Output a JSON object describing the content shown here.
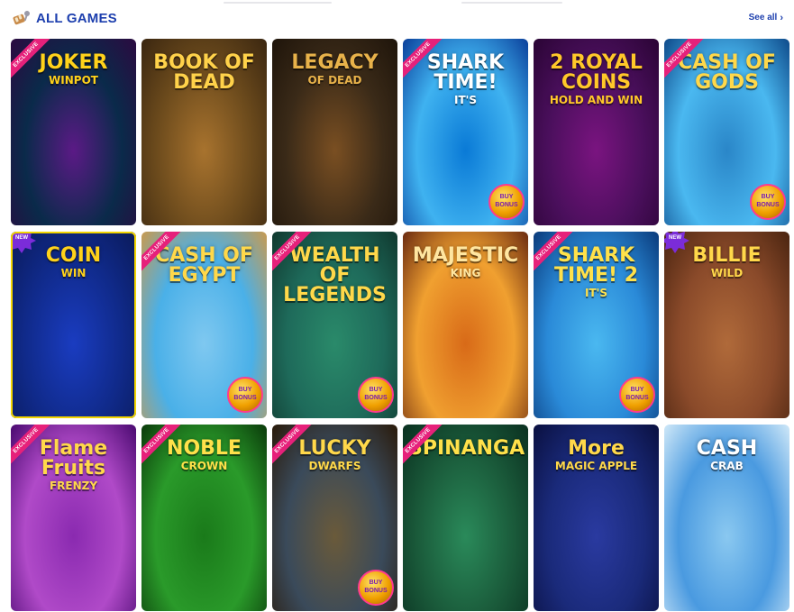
{
  "header": {
    "title": "ALL GAMES",
    "see_all": "See all",
    "accent": "#1d3fae"
  },
  "badges": {
    "exclusive": "EXCLUSIVE",
    "new": "NEW",
    "bonus_line1": "BUY",
    "bonus_line2": "BONUS"
  },
  "games": [
    {
      "key": "joker",
      "l1": "JOKER",
      "l2": "WINPOT",
      "exclusive": true,
      "new": false,
      "bonus": false,
      "bg": [
        "#0a2a4a",
        "#5b1a86",
        "#2b0a40"
      ],
      "logo": "#ffd21a"
    },
    {
      "key": "book",
      "l1": "BOOK OF DEAD",
      "l2": "",
      "exclusive": false,
      "new": false,
      "bonus": false,
      "bg": [
        "#6b4a1c",
        "#a8732e",
        "#3a2610"
      ],
      "logo": "#ffd24a"
    },
    {
      "key": "legacy",
      "l1": "LEGACY",
      "l2": "OF DEAD",
      "exclusive": false,
      "new": false,
      "bonus": false,
      "bg": [
        "#3a2a18",
        "#7a4f22",
        "#1e140a"
      ],
      "logo": "#e8b24a"
    },
    {
      "key": "shark",
      "l1": "SHARK TIME!",
      "l2": "IT'S",
      "exclusive": true,
      "new": false,
      "bonus": true,
      "bg": [
        "#3fb2f0",
        "#0a7ad6",
        "#0b3f9a"
      ],
      "logo": "#ffffff"
    },
    {
      "key": "royal",
      "l1": "2 ROYAL COINS",
      "l2": "HOLD AND WIN",
      "exclusive": false,
      "new": false,
      "bonus": false,
      "bg": [
        "#4a0f5c",
        "#7a1480",
        "#2a0434"
      ],
      "logo": "#ffc829"
    },
    {
      "key": "gods",
      "l1": "CASH OF GODS",
      "l2": "",
      "exclusive": true,
      "new": false,
      "bonus": true,
      "bg": [
        "#4ab8f0",
        "#2a86c8",
        "#0e4a8a"
      ],
      "logo": "#ffd84a"
    },
    {
      "key": "coinwin",
      "l1": "COIN",
      "l2": "WIN",
      "exclusive": false,
      "new": true,
      "bonus": false,
      "highlight": true,
      "bg": [
        "#102a8a",
        "#1a3cc0",
        "#0a1a5a"
      ],
      "logo": "#ffd21a"
    },
    {
      "key": "egypt",
      "l1": "CASH OF EGYPT",
      "l2": "",
      "exclusive": true,
      "new": false,
      "bonus": true,
      "bg": [
        "#4ab0e8",
        "#7fc8f0",
        "#c89a50"
      ],
      "logo": "#ffd84a"
    },
    {
      "key": "wealth",
      "l1": "WEALTH OF LEGENDS",
      "l2": "",
      "exclusive": true,
      "new": false,
      "bonus": true,
      "bg": [
        "#1e6a5a",
        "#2a8a6a",
        "#10382e"
      ],
      "logo": "#ffd84a"
    },
    {
      "key": "majestic",
      "l1": "MAJESTIC",
      "l2": "KING",
      "exclusive": false,
      "new": false,
      "bonus": false,
      "bg": [
        "#f0a030",
        "#d86a18",
        "#6a2a10"
      ],
      "logo": "#ffe6a0"
    },
    {
      "key": "shark2",
      "l1": "SHARK TIME! 2",
      "l2": "IT'S",
      "exclusive": true,
      "new": false,
      "bonus": true,
      "bg": [
        "#2a8ad8",
        "#4ab8f0",
        "#0a3a7a"
      ],
      "logo": "#ffe14a"
    },
    {
      "key": "billie",
      "l1": "BILLIE",
      "l2": "WILD",
      "exclusive": false,
      "new": true,
      "bonus": false,
      "bg": [
        "#8a4a2a",
        "#b06a3a",
        "#4a2410"
      ],
      "logo": "#ffd84a"
    },
    {
      "key": "flame",
      "l1": "Flame Fruits",
      "l2": "FRENZY",
      "exclusive": true,
      "new": false,
      "bonus": false,
      "bg": [
        "#b04ac8",
        "#8a2ab0",
        "#4a0a70"
      ],
      "logo": "#ffd84a"
    },
    {
      "key": "noble",
      "l1": "NOBLE",
      "l2": "CROWN",
      "exclusive": true,
      "new": false,
      "bonus": false,
      "bg": [
        "#2a9a2a",
        "#1a7a1a",
        "#0a3a0a"
      ],
      "logo": "#ffe14a"
    },
    {
      "key": "dwarfs",
      "l1": "LUCKY",
      "l2": "DWARFS",
      "exclusive": true,
      "new": false,
      "bonus": true,
      "bg": [
        "#3a4a5a",
        "#6a5a3a",
        "#2a1a0a"
      ],
      "logo": "#ffd84a"
    },
    {
      "key": "spinanga",
      "l1": "SPINANGA",
      "l2": "",
      "exclusive": true,
      "new": false,
      "bonus": false,
      "bg": [
        "#1a5a3a",
        "#2a8a5a",
        "#0a3020"
      ],
      "logo": "#ffe14a"
    },
    {
      "key": "magic",
      "l1": "More",
      "l2": "MAGIC APPLE",
      "exclusive": false,
      "new": false,
      "bonus": false,
      "bg": [
        "#1a2a7a",
        "#2a3aa0",
        "#0a1040"
      ],
      "logo": "#ffd84a"
    },
    {
      "key": "crab",
      "l1": "CASH",
      "l2": "CRAB",
      "exclusive": false,
      "new": false,
      "bonus": false,
      "bg": [
        "#4a9ae0",
        "#8ac8f0",
        "#cfe8f8"
      ],
      "logo": "#ffffff"
    }
  ]
}
